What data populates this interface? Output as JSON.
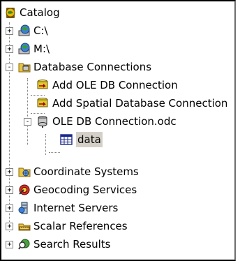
{
  "tree": {
    "root": {
      "label": "Catalog",
      "icon": "catalog-globe-icon"
    },
    "items": [
      {
        "label": "C:\\",
        "icon": "drive-globe-icon",
        "expander": "+"
      },
      {
        "label": "M:\\",
        "icon": "drive-globe-icon",
        "expander": "+"
      },
      {
        "label": "Database Connections",
        "icon": "database-folder-icon",
        "expander": "-"
      },
      {
        "label": "Add OLE DB Connection",
        "icon": "add-connection-icon"
      },
      {
        "label": "Add Spatial Database Connection",
        "icon": "add-connection-icon"
      },
      {
        "label": "OLE DB Connection.odc",
        "icon": "database-icon",
        "expander": "-"
      },
      {
        "label": "data",
        "icon": "table-icon",
        "selected": true
      },
      {
        "label": "Coordinate Systems",
        "icon": "coordinate-systems-icon",
        "expander": "+"
      },
      {
        "label": "Geocoding Services",
        "icon": "geocoding-icon",
        "expander": "+"
      },
      {
        "label": "Internet Servers",
        "icon": "internet-servers-icon",
        "expander": "+"
      },
      {
        "label": "Scalar References",
        "icon": "scalar-ruler-icon",
        "expander": "+"
      },
      {
        "label": "Search Results",
        "icon": "search-results-icon",
        "expander": "+"
      }
    ]
  }
}
